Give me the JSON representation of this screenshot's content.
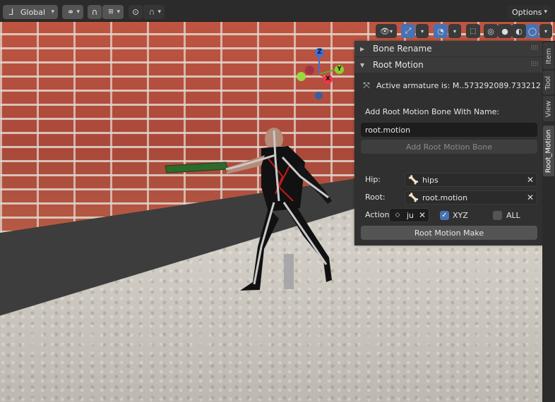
{
  "header": {
    "orientation_label": "Global",
    "options_label": "Options"
  },
  "viewport": {
    "overlay_buttons": [
      "visibility-icon",
      "gizmo-icon",
      "overlays-icon",
      "xray-icon",
      "wireframe-shading-icon",
      "solid-shading-icon",
      "material-shading-icon",
      "rendered-shading-icon"
    ]
  },
  "gizmo": {
    "x": "X",
    "y": "Y",
    "z": "Z"
  },
  "panel": {
    "bone_rename_title": "Bone Rename",
    "root_motion_title": "Root Motion",
    "active_armature": "Active armature is: M..573292089.733212",
    "add_label": "Add Root Motion Bone With Name:",
    "name_value": "root.motion",
    "add_button": "Add Root Motion Bone",
    "hip_label": "Hip:",
    "hip_value": "hips",
    "root_label": "Root:",
    "root_value": "root.motion",
    "action_label": "Action",
    "action_value": "ju",
    "xyz_label": "XYZ",
    "xyz_checked": true,
    "all_label": "ALL",
    "all_checked": false,
    "make_button": "Root Motion Make"
  },
  "tabs": [
    "Item",
    "Tool",
    "View",
    "Root_Motion"
  ],
  "colors": {
    "accent": "#4772b3",
    "panel_bg": "#303030",
    "header_bg": "#2b2b2b"
  }
}
